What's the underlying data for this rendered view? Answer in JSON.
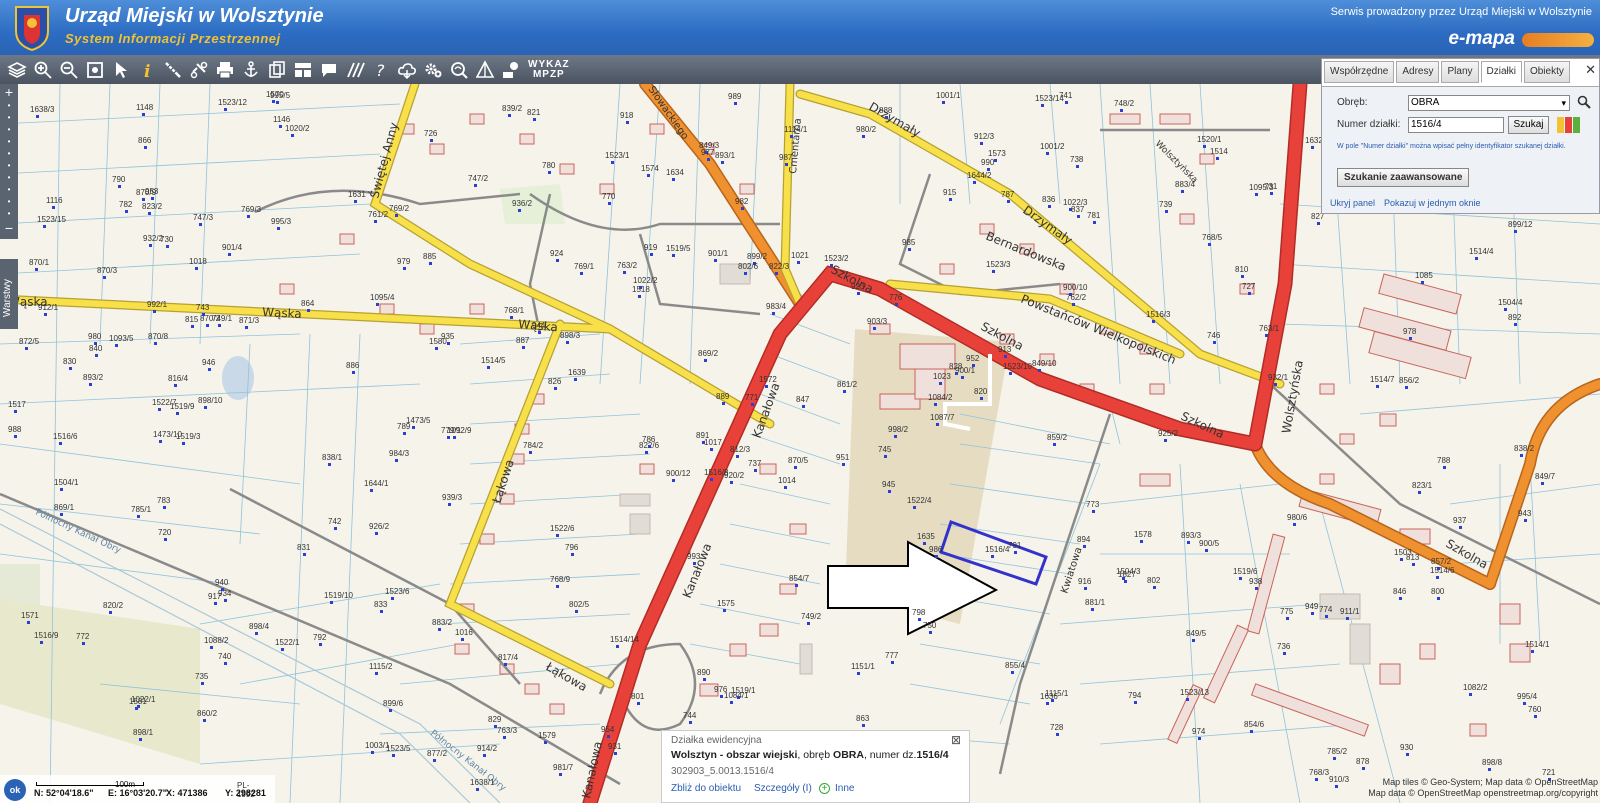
{
  "header": {
    "title": "Urząd Miejski w Wolsztynie",
    "subtitle": "System Informacji Przestrzennej",
    "service_text": "Serwis prowadzony przez Urząd Miejski w Wolsztynie",
    "brand": "e-mapa"
  },
  "toolbar": {
    "icons": [
      "layers-icon",
      "zoom-in-icon",
      "zoom-out-icon",
      "zoom-extent-icon",
      "select-icon",
      "info-icon",
      "measure-icon",
      "link-icon",
      "print-icon",
      "anchor-icon",
      "copy-icon",
      "layout-icon",
      "comment-icon",
      "hatch-icon",
      "help-icon",
      "cloud-icon",
      "settings-icon",
      "search-map-icon",
      "triangle-icon",
      "legend-icon"
    ],
    "wykaz_line1": "WYKAZ",
    "wykaz_line2": "MPZP"
  },
  "search_panel": {
    "tabs": [
      {
        "label": "Współrzędne",
        "active": false
      },
      {
        "label": "Adresy",
        "active": false
      },
      {
        "label": "Plany",
        "active": false
      },
      {
        "label": "Działki",
        "active": true
      },
      {
        "label": "Obiekty",
        "active": false
      }
    ],
    "obreb_label": "Obręb:",
    "obreb_value": "OBRA",
    "numer_label": "Numer działki:",
    "numer_value": "1516/4",
    "search_button": "Szukaj",
    "hint": "W pole \"Numer działki\" można wpisać pełny identyfikator szukanej działki.",
    "advanced_button": "Szukanie zaawansowane",
    "hide_panel": "Ukryj panel",
    "show_in_window": "Pokazuj w jednym oknie"
  },
  "left_nav": {
    "layers_label": "Warstwy"
  },
  "map": {
    "streets": [
      "Wąska",
      "Kanałowa",
      "Szkolna",
      "Powstańców Wielkopolskich",
      "Świętej Anny",
      "Drzymały",
      "Bernardowska",
      "Wolsztyńska",
      "Łąkowa",
      "Kwiatowa",
      "Słowackiego",
      "Cmentarna",
      "Krótka",
      "Kościuszki",
      "Północny Kanał Obry"
    ],
    "highlighted_parcel": "1516/4",
    "parcel_labels": [
      "1014",
      "1018",
      "1017",
      "1022/1",
      "1023",
      "1016",
      "1001/2",
      "1021",
      "1022/3",
      "998/2",
      "1020/2",
      "898/8",
      "898/10",
      "899/12",
      "900/12",
      "900/10",
      "901/1",
      "903/3",
      "898/4",
      "898/3",
      "898/1",
      "899/6",
      "899/2",
      "900/1",
      "900/5",
      "901/4",
      "893/1",
      "893/2",
      "894",
      "892",
      "891",
      "890",
      "889",
      "885",
      "883/4",
      "883/2",
      "878",
      "1082/2",
      "893/3",
      "888",
      "887",
      "886",
      "881/1",
      "877/2",
      "872/5",
      "1084/2",
      "1084/1",
      "1087/7",
      "1088/2",
      "1085",
      "1116",
      "1827",
      "1115/1",
      "1115/2",
      "1146",
      "1148",
      "1151/1",
      "1114/1",
      "1092/9",
      "1093/5",
      "1095/4",
      "1095/3",
      "1570",
      "1573",
      "1574",
      "1572",
      "1571",
      "1575",
      "1579",
      "1578",
      "1580",
      "1581",
      "866",
      "864",
      "869/1",
      "869/2",
      "863",
      "861/2",
      "860/2",
      "859/2",
      "857/2",
      "856/2",
      "854/7",
      "854/6",
      "855/4",
      "849/3",
      "849/7",
      "849/10",
      "849/5",
      "847",
      "846",
      "840",
      "836",
      "837",
      "838/1",
      "839/2",
      "838/2",
      "830",
      "831",
      "833",
      "829",
      "828",
      "827",
      "826",
      "823/1",
      "823/2",
      "822/3",
      "822/6",
      "821",
      "820/2",
      "920/2",
      "919",
      "918",
      "917",
      "923",
      "924",
      "925/2",
      "926/2",
      "930",
      "931",
      "932/1",
      "932/2",
      "934",
      "935",
      "936/2",
      "937",
      "938",
      "939/3",
      "940",
      "943",
      "944",
      "945",
      "946",
      "949",
      "951",
      "952",
      "953",
      "954",
      "974",
      "976",
      "977",
      "978",
      "979",
      "980",
      "981/7",
      "980/6",
      "980/2",
      "982",
      "983/4",
      "984/3",
      "985",
      "986",
      "987",
      "988",
      "989",
      "990",
      "992/1",
      "993",
      "995/4",
      "995/5",
      "910/3",
      "911/1",
      "912/1",
      "912/3",
      "913",
      "914/2",
      "915",
      "916",
      "870/1",
      "870/2",
      "870/3",
      "870/5",
      "870/8",
      "870/9",
      "871/3",
      "815",
      "816/4",
      "817/4",
      "812/3",
      "813",
      "802/5",
      "802/6",
      "810",
      "820",
      "1519/1",
      "1519/3",
      "1519/5",
      "1519/6",
      "1519/10",
      "1519/9",
      "1520/1",
      "1518",
      "1517",
      "1516/3",
      "1516/6",
      "1516/8",
      "1516/9",
      "1516/4",
      "1514",
      "1514/1",
      "1514/4",
      "1514/5",
      "1514/6",
      "1514/7",
      "1514/14",
      "1522/1",
      "1522/4",
      "1522/6",
      "1522/7",
      "1523/1",
      "1523/2",
      "1523/3",
      "1523/5",
      "1523/6",
      "1523/10",
      "1523/12",
      "1523/13",
      "1523/14",
      "1523/15",
      "1638/1",
      "1638/3",
      "1644/1",
      "1644/2",
      "1473/5",
      "1473/10",
      "1504/1",
      "1504/3",
      "1504/4",
      "1503",
      "748/2",
      "749/1",
      "749/2",
      "750",
      "760",
      "761/2",
      "762/2",
      "763/1",
      "763/2",
      "763/3",
      "768/1",
      "768/3",
      "768/5",
      "768/9",
      "777",
      "776",
      "775",
      "774",
      "773",
      "772",
      "771",
      "770",
      "769/1",
      "769/2",
      "769/3",
      "779/1",
      "780",
      "781",
      "782",
      "783",
      "784/2",
      "785/1",
      "785/2",
      "786",
      "787",
      "788",
      "789",
      "790",
      "791",
      "792",
      "794",
      "796",
      "798",
      "800",
      "801",
      "802",
      "720",
      "721",
      "726",
      "727",
      "728",
      "730",
      "731",
      "735",
      "736",
      "737",
      "738",
      "739",
      "740",
      "741",
      "742",
      "743",
      "744",
      "745",
      "746",
      "747/2",
      "747/3",
      "1022/2",
      "1001/1",
      "1003/1",
      "1639",
      "1636",
      "1631",
      "1632",
      "1634",
      "1635",
      "995/3"
    ]
  },
  "info_popup": {
    "title": "Działka ewidencyjna",
    "place": "Wolsztyn - obszar wiejski",
    "obreb_text": ", obręb ",
    "obreb": "OBRA",
    "numer_text": ", numer dz.",
    "numer": "1516/4",
    "identifier": "302903_5.0013.1516/4",
    "link_zoom": "Zbliż do obiektu",
    "link_details": "Szczegóły (I)",
    "link_more": "Inne"
  },
  "bottom_bar": {
    "ok": "ok",
    "scale": "100m",
    "crs": "PL-1992",
    "lat": "N: 52°04'18.6\"",
    "lon": "E: 16°03'20.7\"",
    "x": "X: 471386",
    "y": "Y: 298281"
  },
  "attribution": {
    "line1": "Map tiles © Geo-System; Map data © OpenStreetMap",
    "line2": "Map data © OpenStreetMap openstreetmap.org/copyright"
  },
  "colors": {
    "header_blue": "#2c6cc2",
    "road_red": "#e8413a",
    "road_orange": "#f0912f",
    "road_yellow": "#f8e04a",
    "parcel_line": "#79b6d4",
    "building_outline": "#c8635a",
    "highlight_parcel": "#3333cc"
  }
}
